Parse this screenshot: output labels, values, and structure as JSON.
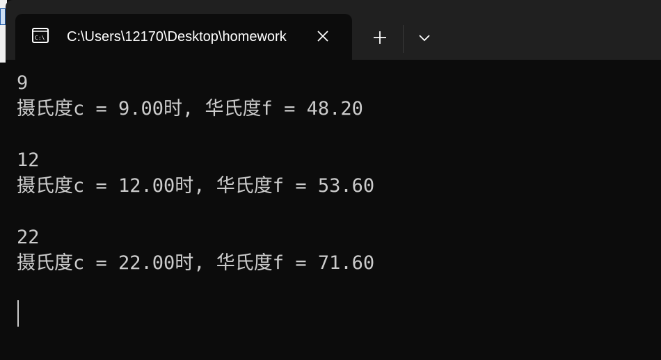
{
  "window": {
    "tab_title": "C:\\Users\\12170\\Desktop\\homework"
  },
  "icons": {
    "tab": "console-icon",
    "close": "close-icon",
    "new_tab": "plus-icon",
    "dropdown": "chevron-down-icon"
  },
  "colors": {
    "titlebar": "#202020",
    "terminal_bg": "#0c0c0c",
    "terminal_text": "#cccccc"
  },
  "terminal": {
    "lines": [
      "9",
      "摄氏度c = 9.00时, 华氏度f = 48.20",
      "",
      "12",
      "摄氏度c = 12.00时, 华氏度f = 53.60",
      "",
      "22",
      "摄氏度c = 22.00时, 华氏度f = 71.60"
    ]
  }
}
